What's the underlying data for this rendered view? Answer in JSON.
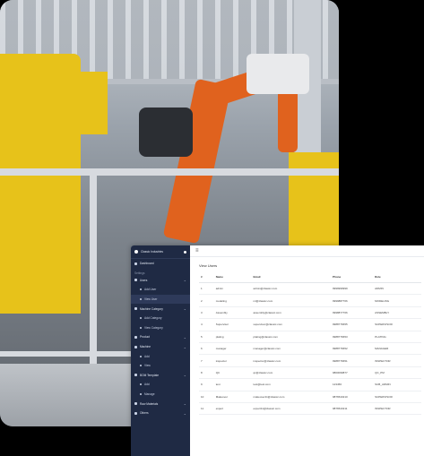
{
  "app": {
    "brand": "Classic Industries"
  },
  "sidebar": {
    "section_label": "Settings",
    "items": [
      {
        "label": "Dashboard",
        "level": "top",
        "chevron": false,
        "active": false
      },
      {
        "label": "Users",
        "level": "top",
        "chevron": true,
        "active": false
      },
      {
        "label": "Add User",
        "level": "sub",
        "chevron": false,
        "active": false
      },
      {
        "label": "View User",
        "level": "sub",
        "chevron": false,
        "active": true
      },
      {
        "label": "Machine Category",
        "level": "top",
        "chevron": true,
        "active": false
      },
      {
        "label": "Add Category",
        "level": "sub",
        "chevron": false,
        "active": false
      },
      {
        "label": "View Category",
        "level": "sub",
        "chevron": false,
        "active": false
      },
      {
        "label": "Product",
        "level": "top",
        "chevron": true,
        "active": false
      },
      {
        "label": "Machine",
        "level": "top",
        "chevron": true,
        "active": false
      },
      {
        "label": "Add",
        "level": "sub",
        "chevron": false,
        "active": false
      },
      {
        "label": "View",
        "level": "sub",
        "chevron": false,
        "active": false
      },
      {
        "label": "BOM Template",
        "level": "top",
        "chevron": true,
        "active": false
      },
      {
        "label": "Add",
        "level": "sub",
        "chevron": false,
        "active": false
      },
      {
        "label": "Manage",
        "level": "sub",
        "chevron": false,
        "active": false
      },
      {
        "label": "Raw Materials",
        "level": "top",
        "chevron": true,
        "active": false
      },
      {
        "label": "Others",
        "level": "top",
        "chevron": true,
        "active": false
      }
    ]
  },
  "main": {
    "page_title": "View Users",
    "table": {
      "headers": [
        "#",
        "Name",
        "Email",
        "Phone",
        "Role"
      ],
      "rows": [
        [
          "1",
          "admin",
          "admin@classic.com",
          "9999999999",
          "ADMIN"
        ],
        [
          "2",
          "modeling",
          "ml@classic.com",
          "9999887766",
          "MODELING"
        ],
        [
          "3",
          "Assembly",
          "assembly@classic.com",
          "9998877766",
          "ASSEMBLY"
        ],
        [
          "4",
          "Supervisor",
          "supervisor@classic.com",
          "9988776655",
          "SUPERVISOR"
        ],
        [
          "5",
          "plating",
          "plating@classic.com",
          "9988776653",
          "PLATING"
        ],
        [
          "6",
          "manager",
          "manager@classic.com",
          "9988776652",
          "MANAGER"
        ],
        [
          "7",
          "inspector",
          "inspector@classic.com",
          "9988776651",
          "INSPECTOR"
        ],
        [
          "8",
          "QC",
          "qc@classic.com",
          "9800099877",
          "QC_PM"
        ],
        [
          "9",
          "test",
          "test@test.com",
          "123456",
          "SUB_ADMIN"
        ],
        [
          "10",
          "Makeover",
          "makeover11@classic.com",
          "9876543210",
          "SUPERVISOR"
        ],
        [
          "11",
          "expert",
          "expert11@classic.com",
          "9876543211",
          "INSPECTOR"
        ]
      ]
    }
  }
}
